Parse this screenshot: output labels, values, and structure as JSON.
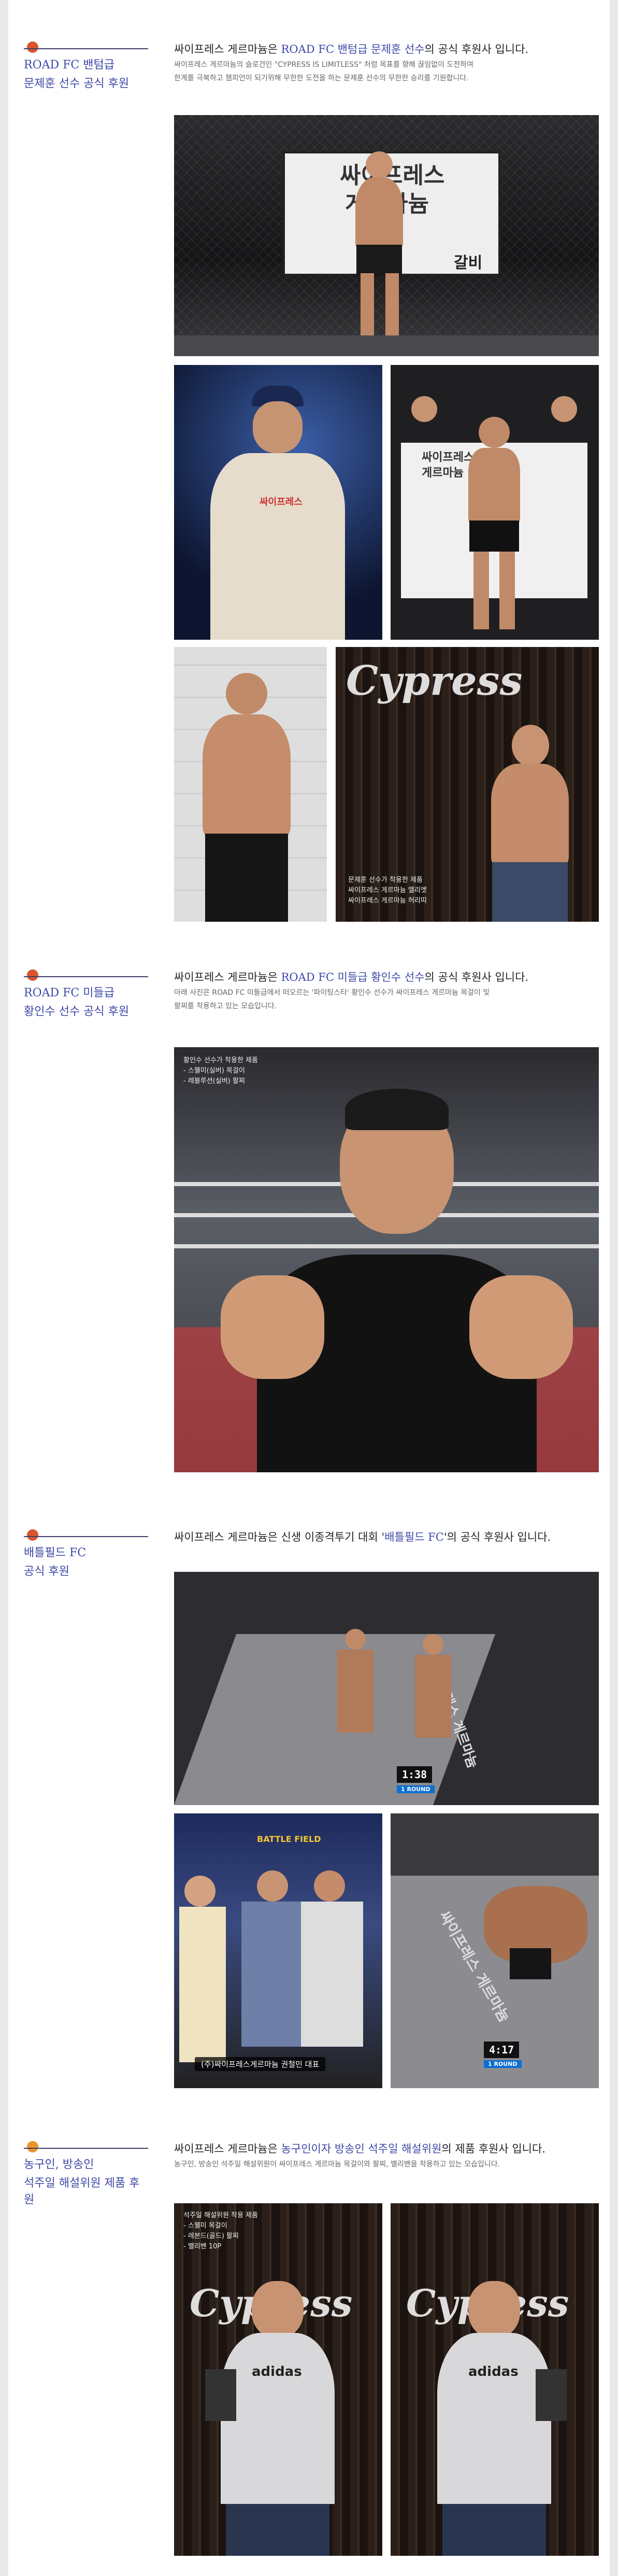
{
  "sections": [
    {
      "ball_color": "#d9552d",
      "side_title_1": "ROAD FC 밴텀급",
      "side_title_2": "문제훈 선수 공식 후원",
      "headline_pre": "싸이프레스 게르마늄은 ",
      "headline_hl": "ROAD FC 밴텀급 문제훈 선수",
      "headline_post": "의 공식 후원사 입니다.",
      "desc_1": "싸이프레스 게르마늄의 슬로건인 \"CYPRESS IS LIMITLESS\" 처럼 목표를 향해 끊임없이 도전하여",
      "desc_2": "한계를 극복하고 챔피언이 되기위해 무한한 도전을 하는 문제훈 선수의 무한한 승리를 기원합니다.",
      "banner_1": "싸이프레스",
      "banner_2": "게르마늄",
      "banner_3": "갈비",
      "caption": "문제훈 선수가 착용한 제품\n싸이프레스 게르마늄 엘리엣\n싸이프레스 게르마늄 허리띠",
      "logo": "Cypress"
    },
    {
      "ball_color": "#d9552d",
      "side_title_1": "ROAD FC 미들급",
      "side_title_2": "황인수 선수 공식 후원",
      "headline_pre": "싸이프레스 게르마늄은 ",
      "headline_hl": "ROAD FC 미들급 황인수 선수",
      "headline_post": "의 공식 후원사 입니다.",
      "desc_1": "아래 사진은 ROAD FC 미들급에서 떠오르는 '파이팅스타' 황인수 선수가 싸이프레스 게르마늄 목걸이 및",
      "desc_2": "팔찌를 착용하고 있는 모습입니다.",
      "caption": "황인수 선수가 착용한 제품\n- 스웰미(실버) 목걸이\n- 레볼루션(실버) 팔찌"
    },
    {
      "ball_color": "#d9552d",
      "side_title_1": "배틀필드 FC",
      "side_title_2": "공식 후원",
      "headline_pre": "싸이프레스 게르마늄은 신생 이종격투기 대회 '",
      "headline_hl": "배틀필드 FC",
      "headline_post": "'의 공식 후원사 입니다.",
      "score_1": "1:38",
      "score_2": "4:17",
      "round": "1 ROUND",
      "mat_text": "싸이프레스 게르마늄",
      "banner": "(주)싸이프레스게르마늄 권철민 대표",
      "small_brand": "BATTLE FIELD"
    },
    {
      "ball_color": "#e8962b",
      "side_title_1": "농구인, 방송인",
      "side_title_2": "석주일 해설위원 제품 후원",
      "headline_pre": "싸이프레스 게르마늄은 ",
      "headline_hl": "농구인이자 방송인 석주일 해설위원",
      "headline_post": "의 제품 후원사 입니다.",
      "desc_1": "농구인, 방송인 석주일 해설위원이 싸이프레스 게르마늄 목걸이와 팔찌, 밸리밴을 착용하고 있는 모습입니다.",
      "caption": "석주일 해설위원 착용 제품\n- 스웰미 목걸이\n- 레본드(골드) 팔찌\n- 밸리밴 10P",
      "logo": "Cypress",
      "shirt": "adidas"
    }
  ]
}
